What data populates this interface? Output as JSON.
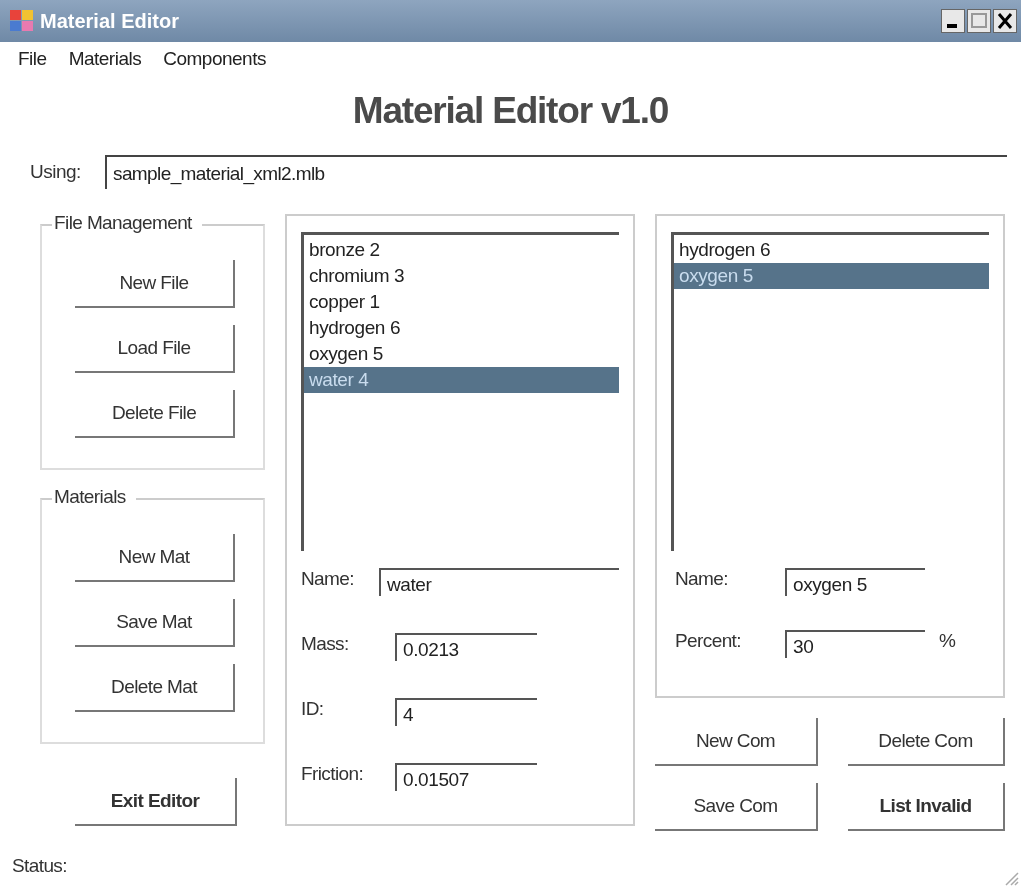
{
  "window": {
    "title": "Material Editor"
  },
  "menu": [
    {
      "label": "File"
    },
    {
      "label": "Materials"
    },
    {
      "label": "Components"
    }
  ],
  "heading": "Material Editor v1.0",
  "using": {
    "label": "Using:",
    "value": "sample_material_xml2.mlb"
  },
  "file_management": {
    "title": "File Management",
    "buttons": [
      {
        "label": "New File",
        "bold": false
      },
      {
        "label": "Load File",
        "bold": false
      },
      {
        "label": "Delete File",
        "bold": false
      }
    ]
  },
  "materials_group": {
    "title": "Materials",
    "buttons": [
      {
        "label": "New Mat",
        "bold": false
      },
      {
        "label": "Save Mat",
        "bold": false
      },
      {
        "label": "Delete Mat",
        "bold": false
      }
    ]
  },
  "exit_button": {
    "label": "Exit Editor",
    "bold": true
  },
  "materials_list": {
    "items": [
      {
        "label": "bronze 2",
        "selected": false
      },
      {
        "label": "chromium 3",
        "selected": false
      },
      {
        "label": "copper 1",
        "selected": false
      },
      {
        "label": "hydrogen 6",
        "selected": false
      },
      {
        "label": "oxygen 5",
        "selected": false
      },
      {
        "label": "water 4",
        "selected": true
      }
    ]
  },
  "material_fields": [
    {
      "label": "Name:",
      "value": "water"
    },
    {
      "label": "Mass:",
      "value": "0.0213"
    },
    {
      "label": "ID:",
      "value": "4"
    },
    {
      "label": "Friction:",
      "value": "0.01507"
    }
  ],
  "components_list": {
    "items": [
      {
        "label": "hydrogen 6",
        "selected": false
      },
      {
        "label": "oxygen 5",
        "selected": true
      }
    ]
  },
  "component_fields": [
    {
      "label": "Name:",
      "value": "oxygen 5"
    },
    {
      "label": "Percent:",
      "value": "30",
      "unit": "%"
    }
  ],
  "component_buttons": [
    {
      "label": "New Com",
      "bold": false
    },
    {
      "label": "Delete Com",
      "bold": false
    },
    {
      "label": "Save Com",
      "bold": false
    },
    {
      "label": "List Invalid",
      "bold": true
    }
  ],
  "status": {
    "label": "Status:"
  }
}
